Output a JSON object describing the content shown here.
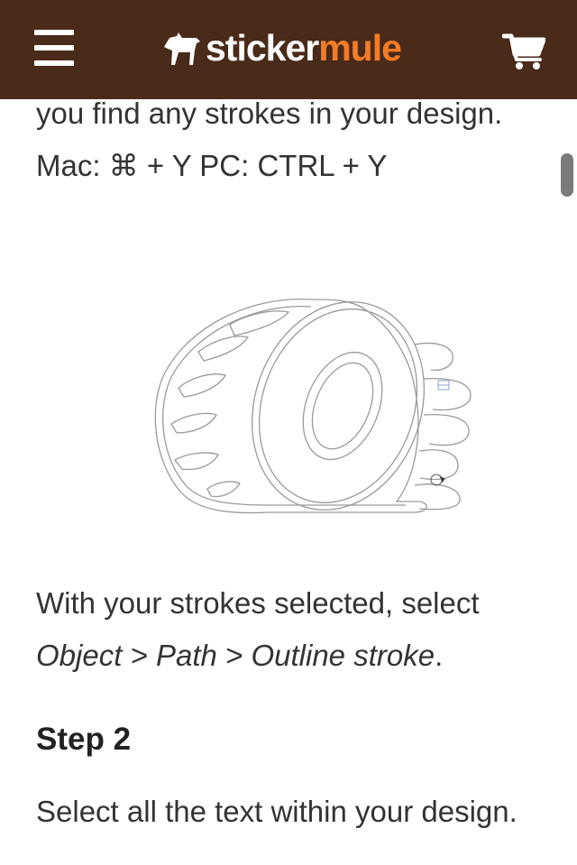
{
  "header": {
    "logo_sticker": "sticker",
    "logo_mule": "mule",
    "menu_icon": "hamburger-menu-icon",
    "cart_icon": "shopping-cart-icon",
    "background_color": "#4a2a19",
    "accent_color": "#f47c26"
  },
  "article": {
    "intro_text": "you find any strokes in your design. Mac: ⌘ + Y PC: CTRL + Y",
    "outline_text_before": "With your strokes selected, select ",
    "outline_path": "Object > Path > Outline stroke",
    "outline_text_after": ".",
    "step_heading": "Step 2",
    "step_text": "Select all the text within your design."
  }
}
